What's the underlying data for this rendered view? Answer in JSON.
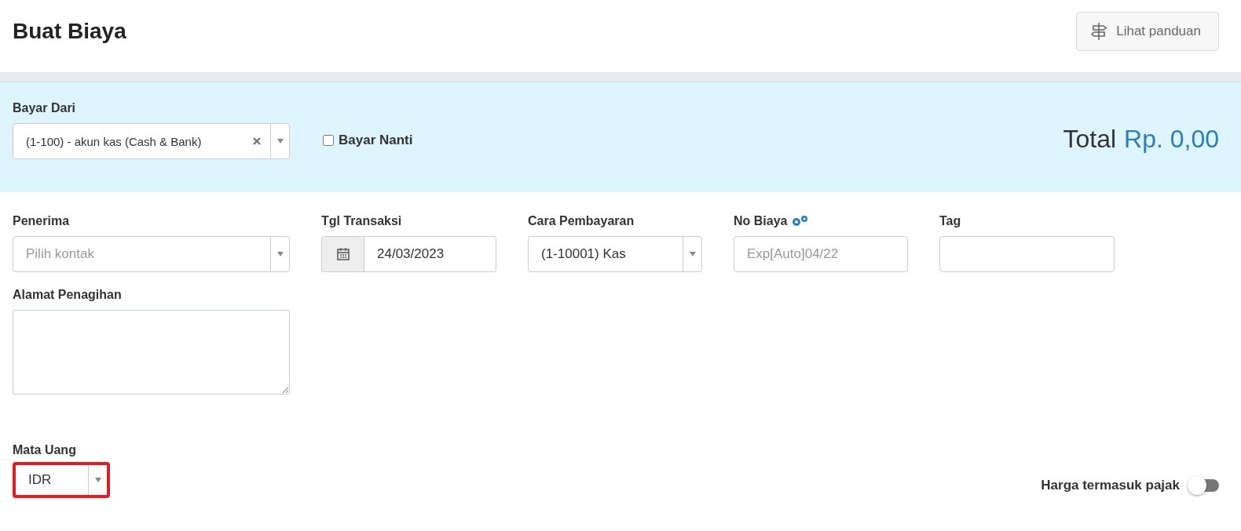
{
  "page": {
    "title": "Buat Biaya",
    "guide_button": "Lihat panduan"
  },
  "payment_panel": {
    "pay_from": {
      "label": "Bayar Dari",
      "value": "(1-100) - akun kas (Cash & Bank)"
    },
    "pay_later": {
      "label": "Bayar Nanti",
      "checked": false
    },
    "total": {
      "label": "Total",
      "amount": "Rp. 0,00"
    }
  },
  "fields": [
    {
      "kind": "select",
      "label": "Penerima",
      "placeholder": "Pilih kontak"
    },
    {
      "kind": "date",
      "label": "Tgl Transaksi",
      "value": "24/03/2023"
    },
    {
      "kind": "select",
      "label": "Cara Pembayaran",
      "value": "(1-10001) Kas"
    },
    {
      "kind": "number",
      "label": "No Biaya",
      "placeholder": "Exp[Auto]04/22"
    },
    {
      "kind": "text",
      "label": "Tag"
    }
  ],
  "billing_address": {
    "label": "Alamat Penagihan"
  },
  "currency": {
    "label": "Mata Uang",
    "value": "IDR",
    "highlighted": true
  },
  "tax_inclusive": {
    "label": "Harga termasuk pajak",
    "on": false
  }
}
